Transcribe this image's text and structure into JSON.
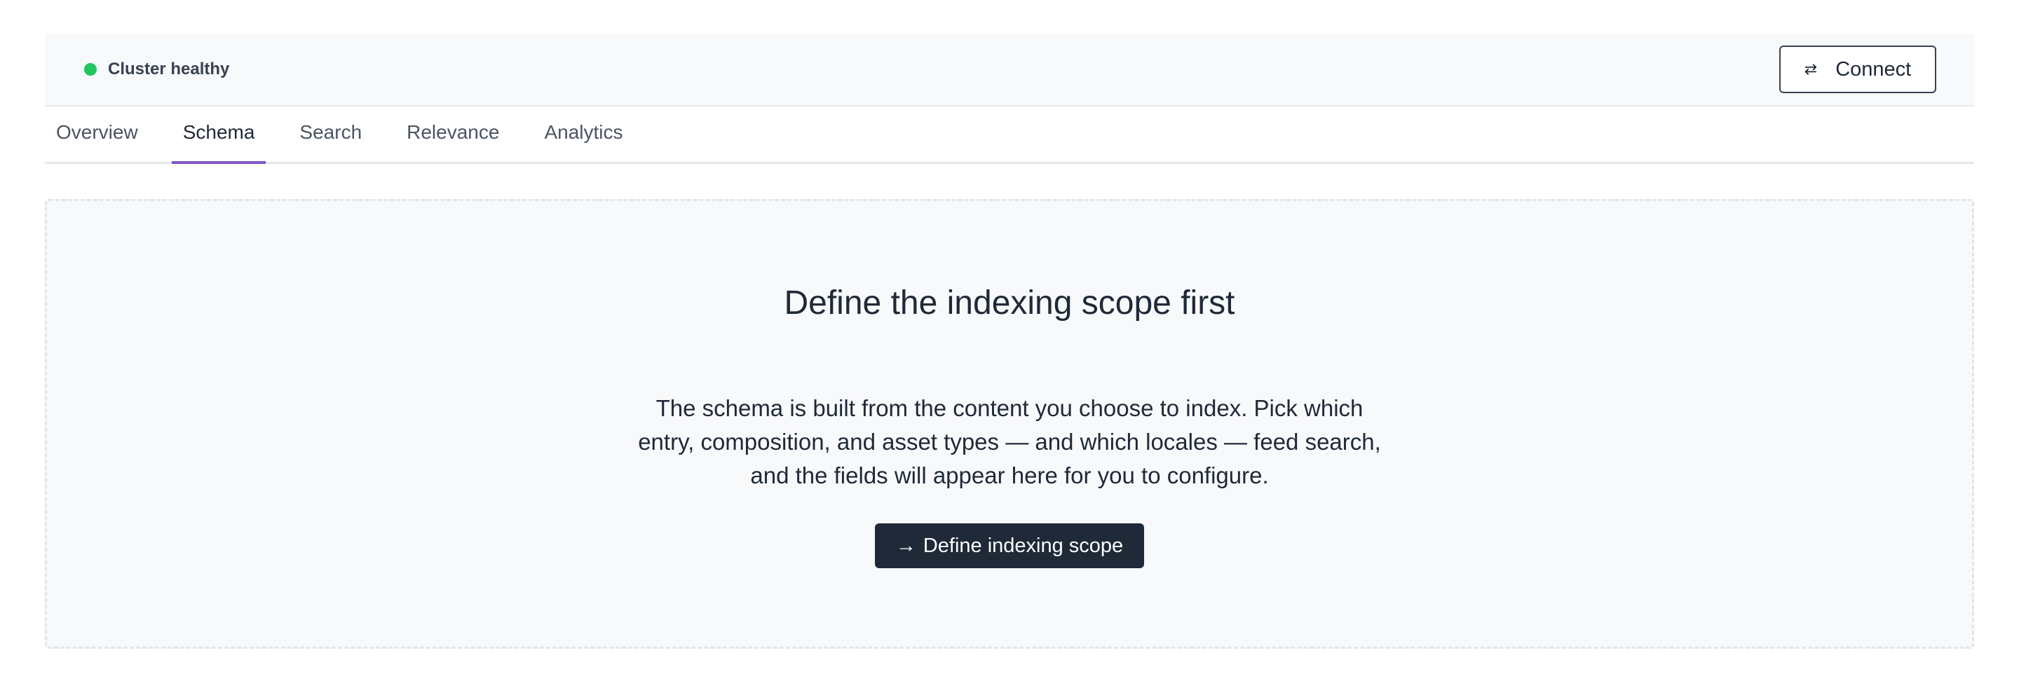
{
  "status": {
    "label": "Cluster healthy",
    "color": "#22c55e"
  },
  "header": {
    "connect_label": "Connect",
    "connect_icon": "swap-arrows-icon"
  },
  "tabs": [
    {
      "label": "Overview",
      "active": false
    },
    {
      "label": "Schema",
      "active": true
    },
    {
      "label": "Search",
      "active": false
    },
    {
      "label": "Relevance",
      "active": false
    },
    {
      "label": "Analytics",
      "active": false
    }
  ],
  "empty_state": {
    "title": "Define the indexing scope first",
    "body": "The schema is built from the content you choose to index. Pick which entry, composition, and asset types — and which locales — feed search, and the fields will appear here for you to configure.",
    "cta_label": "Define indexing scope",
    "cta_icon": "arrow-right-icon"
  },
  "colors": {
    "accent": "#7e57c2",
    "primary_button": "#1f2937"
  }
}
